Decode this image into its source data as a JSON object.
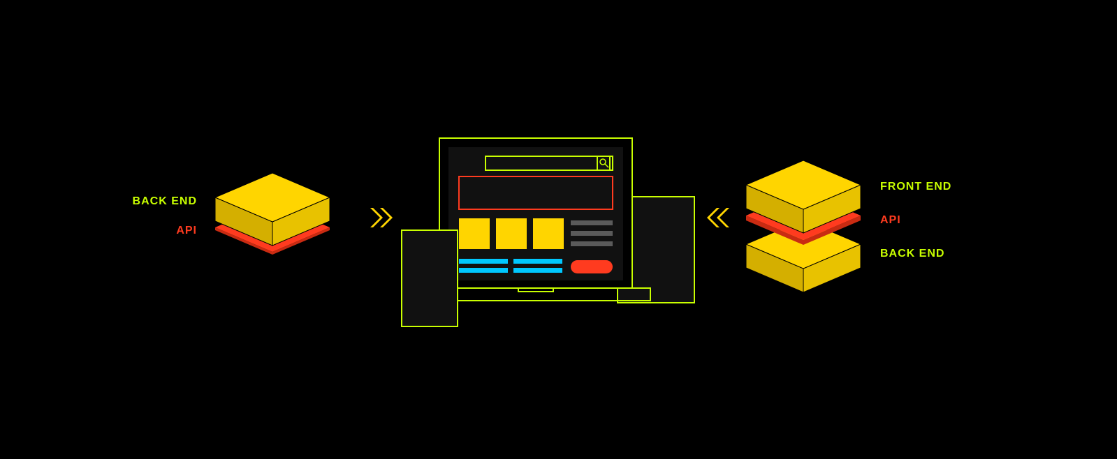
{
  "colors": {
    "bg": "#000000",
    "yellow": "#FFD500",
    "yellowDark": "#D4AF00",
    "lime": "#C9FF00",
    "red": "#FF3B1F",
    "redDark": "#C92B12",
    "cyan": "#00C8FF",
    "gray": "#5A5A5A",
    "dark": "#111111"
  },
  "left": {
    "backend_label": "BACK END",
    "api_label": "API"
  },
  "right": {
    "frontend_label": "FRONT END",
    "api_label": "API",
    "backend_label": "BACK END"
  },
  "icons": {
    "arrow_right": "double-chevron-right-icon",
    "arrow_left": "double-chevron-left-icon",
    "search": "search-icon"
  }
}
